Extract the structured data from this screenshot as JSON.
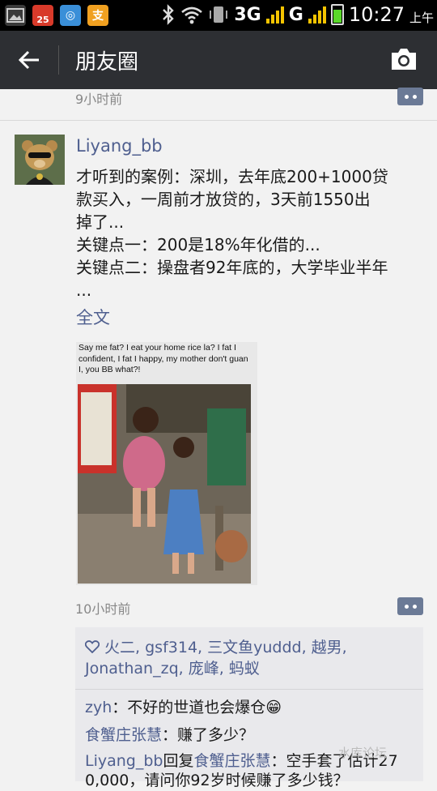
{
  "status_bar": {
    "network": "3G",
    "network2": "G",
    "time": "10:27",
    "ampm": "上午",
    "notif_badge": "25",
    "icons": [
      "image-icon",
      "calendar-icon",
      "browser-icon",
      "alipay-icon",
      "bluetooth-icon",
      "wifi-icon",
      "vibrate-icon",
      "signal-icon",
      "battery-icon"
    ]
  },
  "titlebar": {
    "title": "朋友圈"
  },
  "previous_post": {
    "time": "9小时前"
  },
  "post": {
    "username": "Liyang_bb",
    "text": "才听到的案例：深圳，去年底200+1000贷\n款买入，一周前才放贷的，3天前1550出\n掉了...\n关键点一：200是18%年化借的...\n关键点二：操盘者92年底的，大学毕业半年\n...",
    "full_text_link": "全文",
    "image_caption": "Say me fat? I eat your home rice la? I fat I confident, I fat I happy, my mother don't guan I, you BB what?!",
    "time": "10小时前",
    "likes": "火二, gsf314, 三文鱼yuddd, 越男, Jonathan_zq, 庞峰, 蚂蚁",
    "comments": [
      {
        "name": "zyh",
        "text": "：不好的世道也会爆仓😁"
      },
      {
        "name": "食蟹庄张慧",
        "text": "：赚了多少？"
      },
      {
        "name": "Liyang_bb",
        "reply_word": "回复",
        "reply_to": "食蟹庄张慧",
        "text": "：空手套了估计27"
      },
      {
        "text": "0,000，请问你92岁时候赚了多少钱？"
      }
    ]
  },
  "watermark": "水库论坛",
  "colors": {
    "titlebar": "#2d2f33",
    "link": "#4f5f8f",
    "comment_box": "#e9e9ec"
  }
}
